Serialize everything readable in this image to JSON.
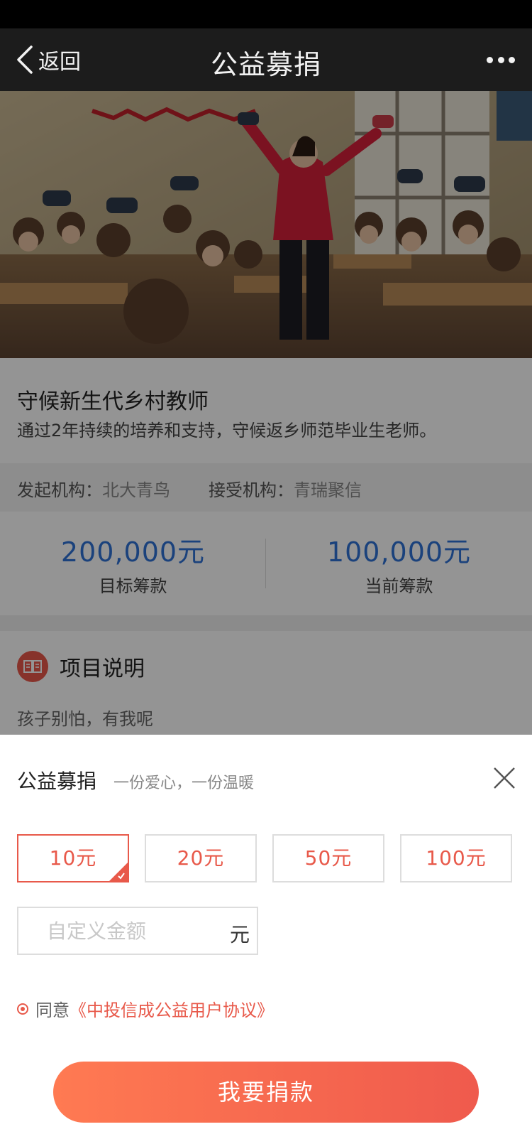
{
  "nav": {
    "back_label": "返回",
    "title": "公益募捐"
  },
  "project": {
    "title": "守候新生代乡村教师",
    "description": "通过2年持续的培养和支持，守候返乡师范毕业生老师。"
  },
  "organizations": {
    "initiator_label": "发起机构：",
    "initiator_value": "北大青鸟",
    "receiver_label": "接受机构：",
    "receiver_value": "青瑞聚信"
  },
  "stats": {
    "target_amount": "200,000元",
    "target_label": "目标筹款",
    "current_amount": "100,000元",
    "current_label": "当前筹款"
  },
  "section": {
    "title": "项目说明",
    "text": "孩子别怕，有我呢"
  },
  "sheet": {
    "title": "公益募捐",
    "subtitle": "一份爱心，一份温暖",
    "amounts": [
      "10元",
      "20元",
      "50元",
      "100元"
    ],
    "selected_amount": "10元",
    "custom_placeholder": "自定义金额",
    "unit": "元",
    "agree_label": "同意",
    "agreement_link": "《中投信成公益用户协议》",
    "donate_label": "我要捐款"
  },
  "colors": {
    "accent": "#e8594a",
    "stat_blue": "#2f72d6",
    "nav_bg": "#1c1c1c"
  }
}
